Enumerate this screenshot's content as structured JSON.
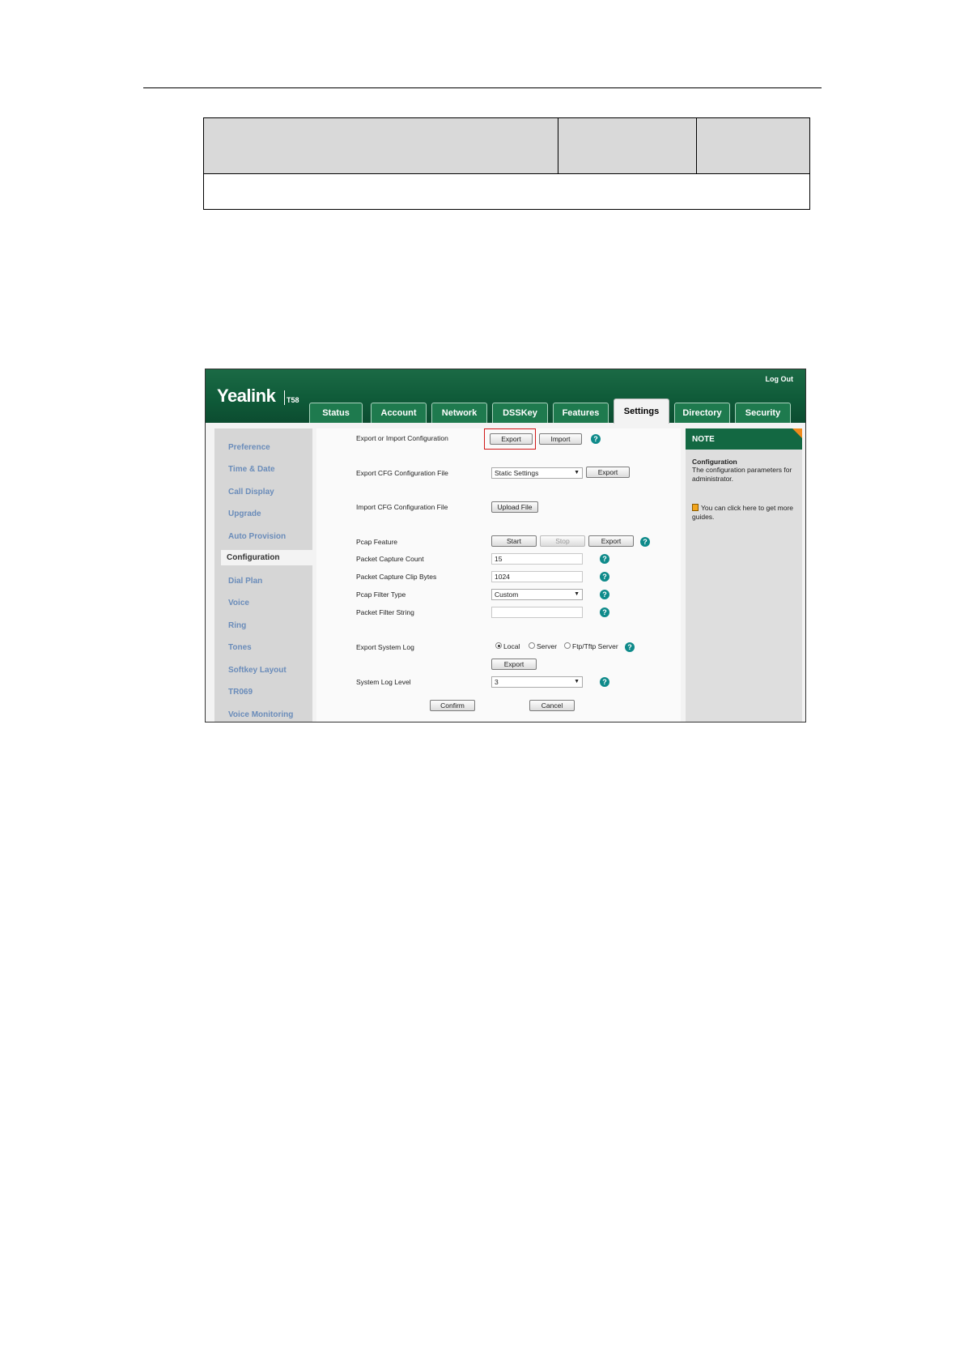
{
  "app": {
    "logo": "Yealink",
    "model": "T58",
    "logout": "Log Out"
  },
  "tabs": [
    {
      "label": "Status"
    },
    {
      "label": "Account"
    },
    {
      "label": "Network"
    },
    {
      "label": "DSSKey"
    },
    {
      "label": "Features"
    },
    {
      "label": "Settings",
      "active": true
    },
    {
      "label": "Directory"
    },
    {
      "label": "Security"
    }
  ],
  "sidebar": {
    "items": [
      {
        "label": "Preference"
      },
      {
        "label": "Time & Date"
      },
      {
        "label": "Call Display"
      },
      {
        "label": "Upgrade"
      },
      {
        "label": "Auto Provision"
      },
      {
        "label": "Configuration",
        "active": true
      },
      {
        "label": "Dial Plan"
      },
      {
        "label": "Voice"
      },
      {
        "label": "Ring"
      },
      {
        "label": "Tones"
      },
      {
        "label": "Softkey Layout"
      },
      {
        "label": "TR069"
      },
      {
        "label": "Voice Monitoring"
      }
    ]
  },
  "form": {
    "export_import": {
      "label": "Export or Import Configuration",
      "export": "Export",
      "import": "Import"
    },
    "export_cfg": {
      "label": "Export CFG Configuration File",
      "select": "Static Settings",
      "export": "Export"
    },
    "import_cfg": {
      "label": "Import CFG Configuration File",
      "upload": "Upload File"
    },
    "pcap": {
      "label": "Pcap Feature",
      "start": "Start",
      "stop": "Stop",
      "export": "Export"
    },
    "packet_count": {
      "label": "Packet Capture Count",
      "value": "15"
    },
    "clip_bytes": {
      "label": "Packet Capture Clip Bytes",
      "value": "1024"
    },
    "filter_type": {
      "label": "Pcap Filter Type",
      "value": "Custom"
    },
    "filter_string": {
      "label": "Packet Filter String",
      "value": ""
    },
    "syslog": {
      "label": "Export System Log",
      "opt_local": "Local",
      "opt_server": "Server",
      "opt_ftp": "Ftp/Tftp Server",
      "export": "Export"
    },
    "log_level": {
      "label": "System Log Level",
      "value": "3"
    },
    "confirm": "Confirm",
    "cancel": "Cancel"
  },
  "note": {
    "head": "NOTE",
    "title": "Configuration",
    "text": "The configuration parameters for administrator.",
    "guide": "You can click here to get more guides."
  },
  "colors": {
    "header_green": "#0f5b39",
    "highlight_red": "#d01818",
    "help_teal": "#0e8a8a",
    "sidebar_link": "#6a8cba"
  }
}
